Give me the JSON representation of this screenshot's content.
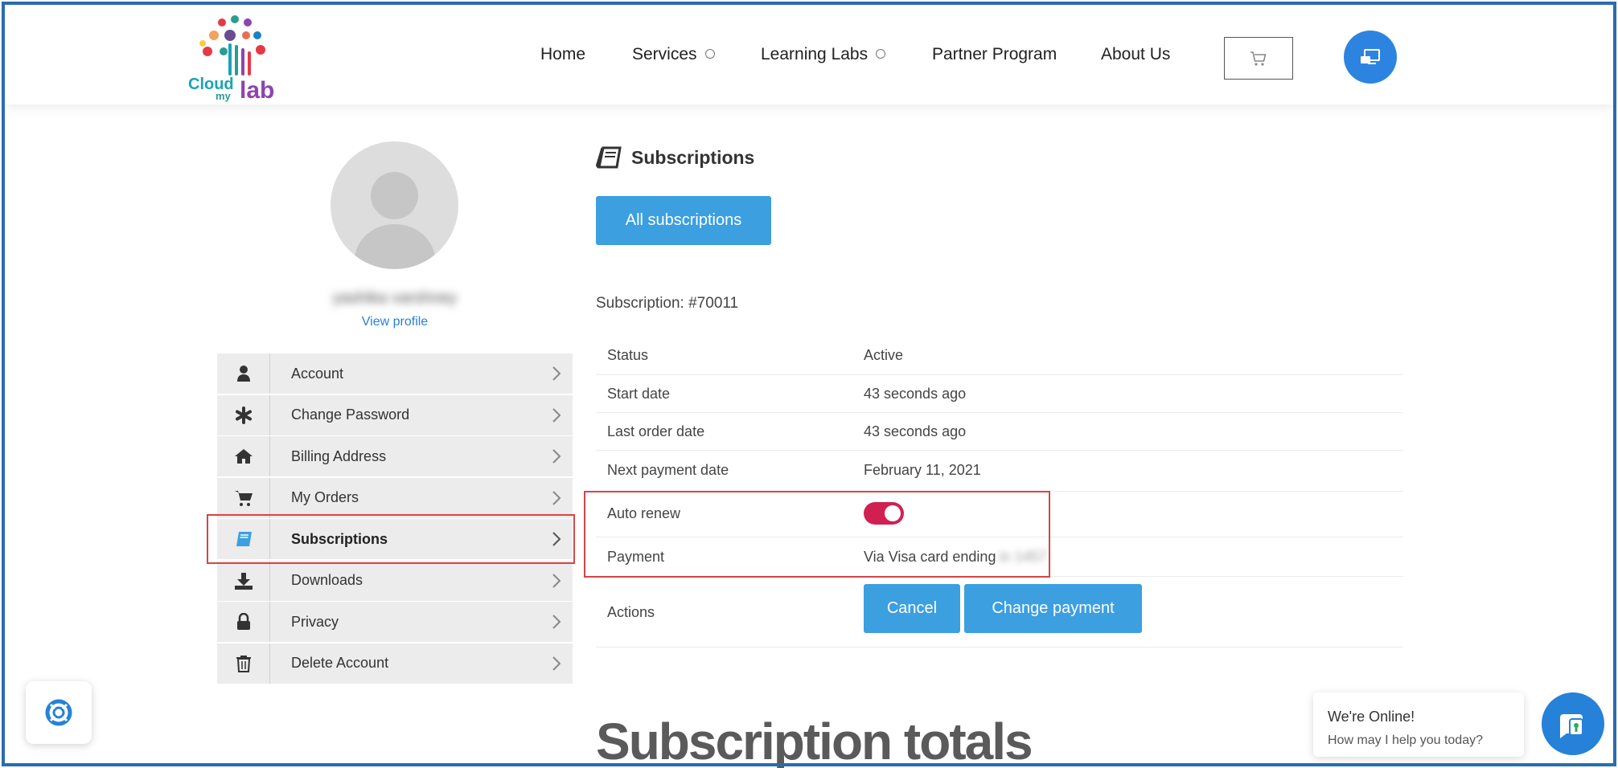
{
  "header": {
    "logo": {
      "cloud": "Cloud",
      "my": "my",
      "lab": "lab"
    },
    "nav": [
      {
        "label": "Home"
      },
      {
        "label": "Services"
      },
      {
        "label": "Learning Labs"
      },
      {
        "label": "Partner Program"
      },
      {
        "label": "About Us"
      }
    ],
    "cart_icon": "cart-icon",
    "remote_icon": "remote-support-icon"
  },
  "profile": {
    "username": "yashika varshney",
    "view_profile": "View profile"
  },
  "menu": [
    {
      "label": "Account",
      "icon": "user-icon"
    },
    {
      "label": "Change Password",
      "icon": "asterisk-icon"
    },
    {
      "label": "Billing Address",
      "icon": "home-icon"
    },
    {
      "label": "My Orders",
      "icon": "cart-icon"
    },
    {
      "label": "Subscriptions",
      "icon": "book-icon",
      "active": true
    },
    {
      "label": "Downloads",
      "icon": "download-icon"
    },
    {
      "label": "Privacy",
      "icon": "lock-icon"
    },
    {
      "label": "Delete Account",
      "icon": "trash-icon"
    }
  ],
  "main": {
    "title": "Subscriptions",
    "all_subscriptions": "All subscriptions",
    "subscription_id": "Subscription: #70011",
    "details": {
      "status": {
        "label": "Status",
        "value": "Active"
      },
      "start_date": {
        "label": "Start date",
        "value": "43 seconds ago"
      },
      "last_order_date": {
        "label": "Last order date",
        "value": "43 seconds ago"
      },
      "next_payment_date": {
        "label": "Next payment date",
        "value": "February 11, 2021"
      },
      "auto_renew": {
        "label": "Auto renew",
        "enabled": true
      },
      "payment": {
        "label": "Payment",
        "value": "Via Visa card ending",
        "masked_digits": "in 1457"
      },
      "actions": {
        "label": "Actions",
        "cancel": "Cancel",
        "change_payment": "Change payment"
      }
    },
    "totals_heading": "Subscription totals"
  },
  "chat": {
    "line1": "We're Online!",
    "line2": "How may I help you today?"
  },
  "colors": {
    "accent_blue": "#3b9fe0",
    "toggle_on": "#d21f52",
    "highlight": "#d64545",
    "frame": "#2a6cb0"
  }
}
